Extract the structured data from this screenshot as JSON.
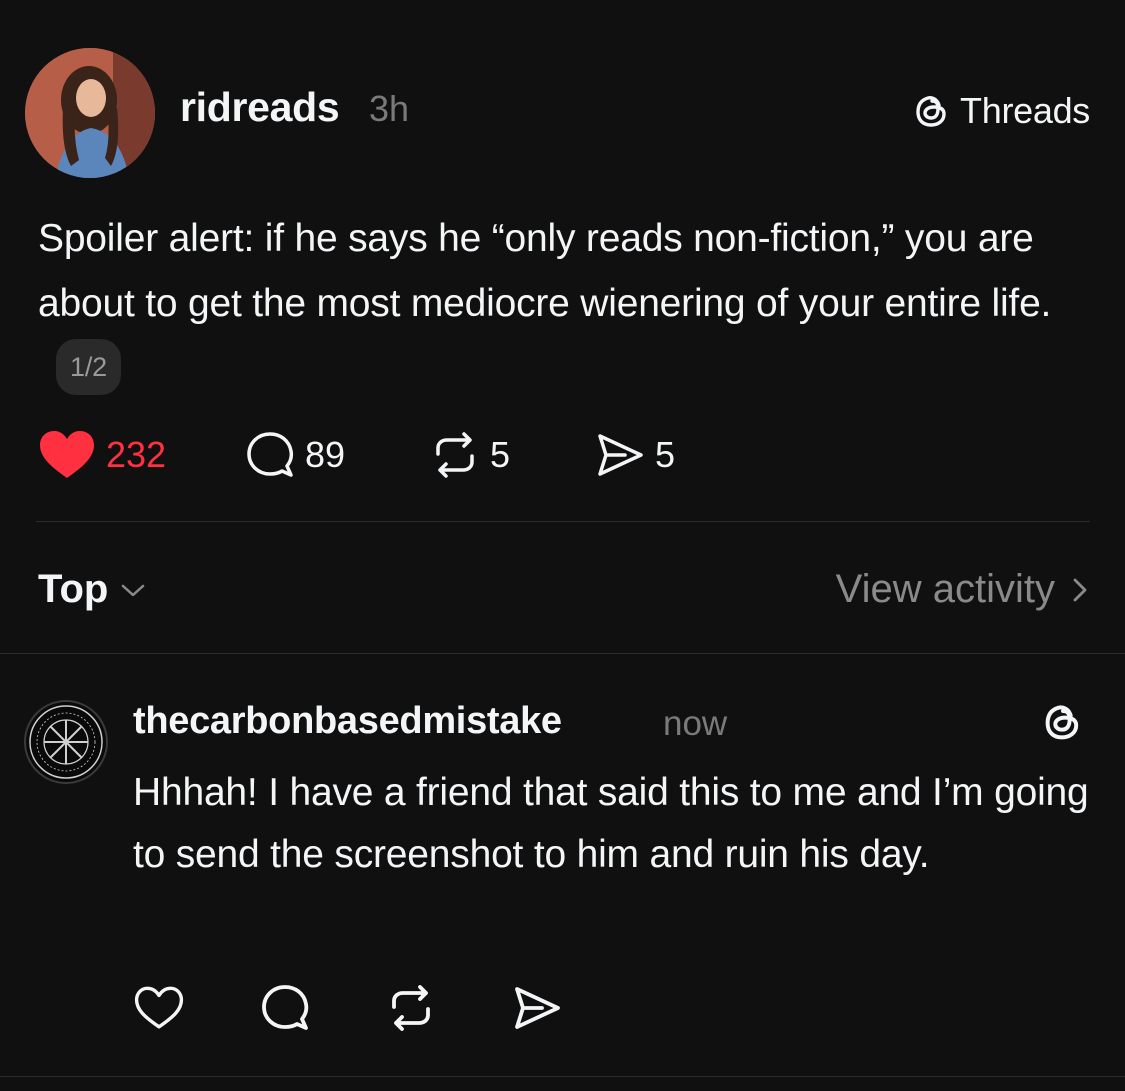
{
  "post": {
    "username": "ridreads",
    "time": "3h",
    "brand_label": "Threads",
    "text": "Spoiler alert: if he says he “only reads non-fiction,” you are about to get the most mediocre wienering of your entire life.",
    "page_indicator": "1/2",
    "stats": {
      "likes": "232",
      "replies": "89",
      "reposts": "5",
      "shares": "5"
    },
    "like_color": "#ff3040"
  },
  "sort": {
    "label": "Top",
    "view_activity": "View activity"
  },
  "reply": {
    "username": "thecarbonbasedmistake",
    "time": "now",
    "text": "Hhhah! I have a friend that said this to me and I’m going to send the screenshot to him and ruin his day."
  },
  "icons": {
    "brand": "threads-logo-icon",
    "like": "heart-icon",
    "reply": "speech-bubble-icon",
    "repost": "repost-icon",
    "share": "paper-plane-icon",
    "sort": "chevron-down-icon",
    "view_activity": "chevron-right-icon"
  },
  "colors": {
    "background": "#101010",
    "text": "#f3f5f7",
    "muted": "#7a7a7a"
  }
}
